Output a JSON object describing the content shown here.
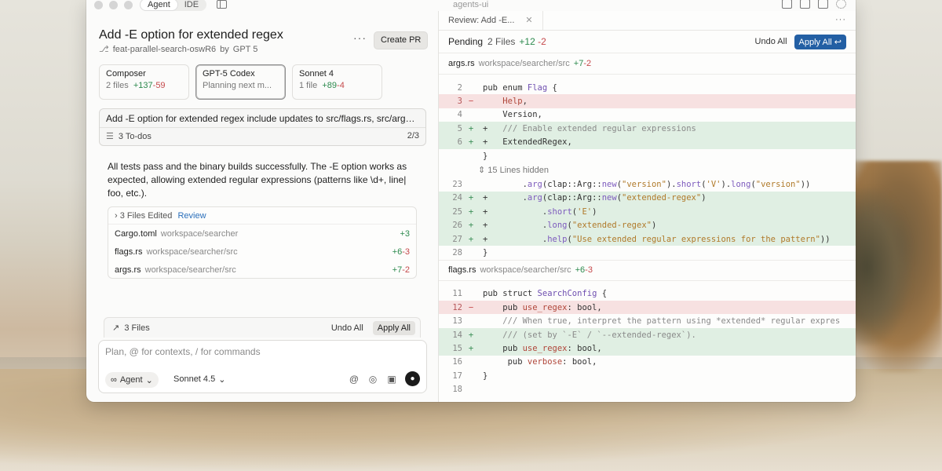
{
  "window": {
    "title": "agents-ui",
    "segment": {
      "agent": "Agent",
      "ide": "IDE"
    }
  },
  "task": {
    "title": "Add -E option for extended regex",
    "branch": "feat-parallel-search-oswR6",
    "by_label": "by",
    "model": "GPT 5",
    "more": "···",
    "create_pr": "Create PR"
  },
  "agents": [
    {
      "name": "Composer",
      "files": "2 files",
      "add": "+137",
      "del": "-59"
    },
    {
      "name": "GPT-5 Codex",
      "status": "Planning next m..."
    },
    {
      "name": "Sonnet 4",
      "files": "1 file",
      "add": "+89",
      "del": "-4"
    }
  ],
  "summary": {
    "text": "Add -E option for extended regex include updates to src/flags.rs, src/args.rs",
    "todos": "3 To-dos",
    "progress": "2/3"
  },
  "result_text": "All tests pass and the binary builds successfully. The -E option works as expected, allowing extended regular expressions (patterns like \\d+, line| foo, etc.).",
  "edits": {
    "header": "3 Files Edited",
    "review": "Review",
    "files": [
      {
        "name": "Cargo.toml",
        "path": "workspace/searcher",
        "add": "+3",
        "del": ""
      },
      {
        "name": "flags.rs",
        "path": "workspace/searcher/src",
        "add": "+6",
        "del": "-3"
      },
      {
        "name": "args.rs",
        "path": "workspace/searcher/src",
        "add": "+7",
        "del": "-2"
      }
    ]
  },
  "files_bar": {
    "label": "3 Files",
    "undo": "Undo All",
    "apply": "Apply All"
  },
  "composer": {
    "placeholder": "Plan, @ for contexts, / for commands",
    "mode": "Agent",
    "model": "Sonnet 4.5"
  },
  "review": {
    "tab": "Review: Add -E...",
    "more": "···",
    "pending_label": "Pending",
    "pending_files": "2 Files",
    "add": "+12",
    "del": "-2",
    "undo": "Undo All",
    "apply": "Apply All ↩"
  },
  "diff_files": [
    {
      "name": "args.rs",
      "path": "workspace/searcher/src",
      "add": "+7",
      "del": "-2"
    },
    {
      "name": "flags.rs",
      "path": "workspace/searcher/src",
      "add": "+6",
      "del": "-3"
    }
  ],
  "hidden_label": "15 Lines hidden",
  "colors": {
    "accent": "#235fa4",
    "added": "#2d8a4e",
    "deleted": "#c5494b",
    "added_bg": "#e0efe3",
    "deleted_bg": "#f7e1e1"
  }
}
